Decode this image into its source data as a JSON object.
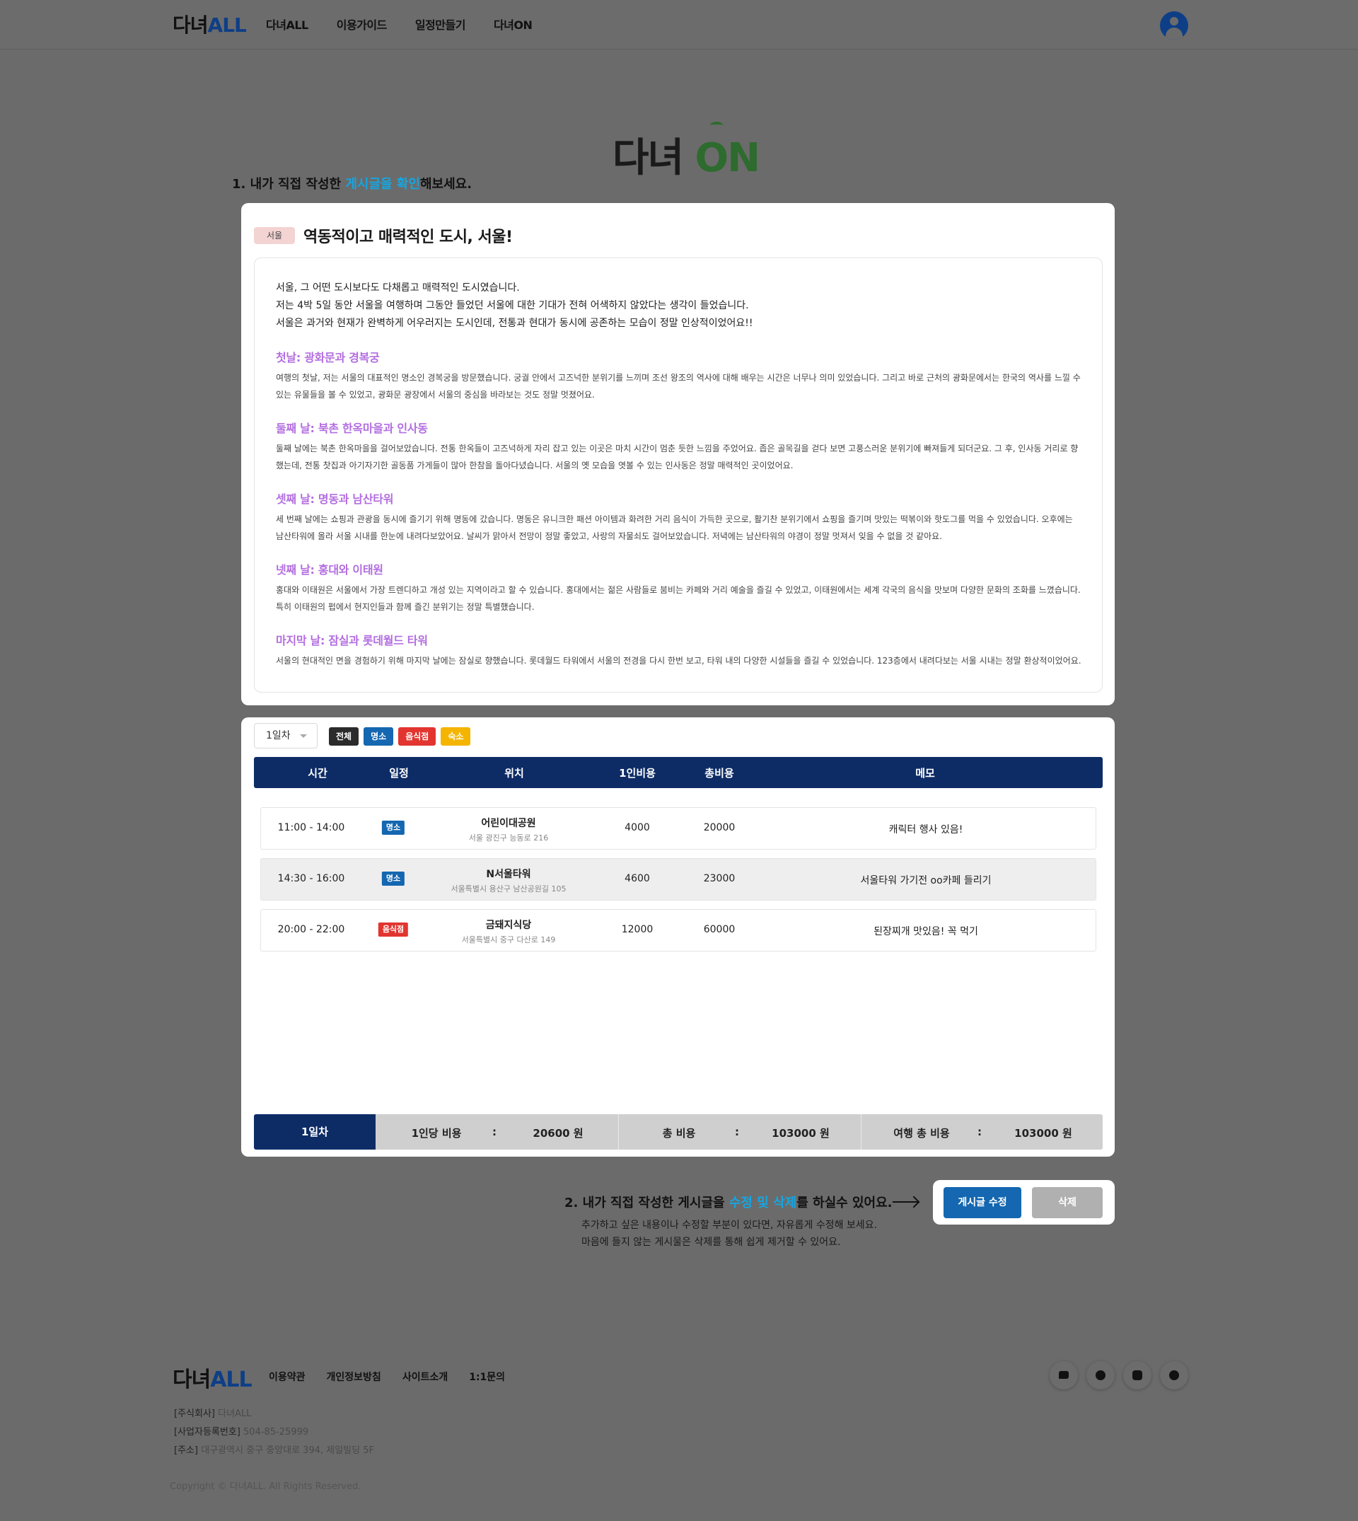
{
  "header": {
    "logo_prefix": "다녀",
    "logo_suffix": "ALL",
    "nav": [
      "다녀ALL",
      "이용가이드",
      "일정만들기",
      "다녀ON"
    ]
  },
  "hero": {
    "logo_prefix": "다녀 ",
    "logo_suffix": "ON"
  },
  "section1": {
    "prefix": "1. 내가 직접 작성한 ",
    "highlight": "게시글을 확인",
    "suffix": "해보세요."
  },
  "post": {
    "region": "서울",
    "title": "역동적이고 매력적인 도시, 서울!",
    "intro": [
      "서울, 그 어떤 도시보다도 다채롭고 매력적인 도시였습니다.",
      "저는 4박 5일 동안 서울을 여행하며 그동안 들었던 서울에 대한 기대가 전혀 어색하지 않았다는 생각이 들었습니다.",
      "서울은 과거와 현재가 완벽하게 어우러지는 도시인데, 전통과 현대가 동시에 공존하는 모습이 정말 인상적이었어요!!"
    ],
    "days": [
      {
        "heading": "첫날: 광화문과 경복궁",
        "text": "여행의 첫날, 저는 서울의 대표적인 명소인 경복궁을 방문했습니다. 궁궐 안에서 고즈넉한 분위기를 느끼며 조선 왕조의 역사에 대해 배우는 시간은 너무나 의미 있었습니다. 그리고 바로 근처의 광화문에서는 한국의 역사를 느낄 수 있는 유물들을 볼 수 있었고, 광화문 광장에서 서울의 중심을 바라보는 것도 정말 멋졌어요."
      },
      {
        "heading": "둘째 날: 북촌 한옥마을과 인사동",
        "text": "둘째 날에는 북촌 한옥마을을 걸어보았습니다. 전통 한옥들이 고즈넉하게 자리 잡고 있는 이곳은 마치 시간이 멈춘 듯한 느낌을 주었어요. 좁은 골목길을 걷다 보면 고풍스러운 분위기에 빠져들게 되더군요. 그 후, 인사동 거리로 향했는데, 전통 찻집과 아기자기한 골동품 가게들이 많아 한참을 돌아다녔습니다. 서울의 옛 모습을 엿볼 수 있는 인사동은 정말 매력적인 곳이었어요."
      },
      {
        "heading": "셋째 날: 명동과 남산타워",
        "text": "세 번째 날에는 쇼핑과 관광을 동시에 즐기기 위해 명동에 갔습니다. 명동은 유니크한 패션 아이템과 화려한 거리 음식이 가득한 곳으로, 활기찬 분위기에서 쇼핑을 즐기며 맛있는 떡볶이와 핫도그를 먹을 수 있었습니다. 오후에는 남산타워에 올라 서울 시내를 한눈에 내려다보았어요. 날씨가 맑아서 전망이 정말 좋았고, 사랑의 자물쇠도 걸어보았습니다. 저녁에는 남산타워의 야경이 정말 멋져서 잊을 수 없을 것 같아요."
      },
      {
        "heading": "넷째 날: 홍대와 이태원",
        "text": "홍대와 이태원은 서울에서 가장 트렌디하고 개성 있는 지역이라고 할 수 있습니다. 홍대에서는 젊은 사람들로 붐비는 카페와 거리 예술을 즐길 수 있었고, 이태원에서는 세계 각국의 음식을 맛보며 다양한 문화의 조화를 느꼈습니다. 특히 이태원의 펍에서 현지인들과 함께 즐긴 분위기는 정말 특별했습니다."
      },
      {
        "heading": "마지막 날: 잠실과 롯데월드 타워",
        "text": "서울의 현대적인 면을 경험하기 위해 마지막 날에는 잠실로 향했습니다. 롯데월드 타워에서 서울의 전경을 다시 한번 보고, 타워 내의 다양한 시설들을 즐길 수 있었습니다. 123층에서 내려다보는 서울 시내는 정말 환상적이었어요."
      }
    ]
  },
  "schedule": {
    "day_select": "1일차",
    "filters": [
      "전체",
      "명소",
      "음식점",
      "숙소"
    ],
    "columns": [
      "시간",
      "일정",
      "위치",
      "1인비용",
      "총비용",
      "메모"
    ],
    "rows": [
      {
        "time": "11:00 - 14:00",
        "type": "명소",
        "place": "어린이대공원",
        "address": "서울 광진구 능동로 216",
        "cost_per_person": "4000",
        "total": "20000",
        "memo": "캐릭터 행사 있음!"
      },
      {
        "time": "14:30 - 16:00",
        "type": "명소",
        "place": "N서울타워",
        "address": "서울특별시 용산구 남산공원길 105",
        "cost_per_person": "4600",
        "total": "23000",
        "memo": "서울타워 가기전 oo카페 들리기"
      },
      {
        "time": "20:00 - 22:00",
        "type": "음식점",
        "place": "금돼지식당",
        "address": "서울특별시 중구 다산로 149",
        "cost_per_person": "12000",
        "total": "60000",
        "memo": "된장찌개 맛있음! 꼭 먹기"
      }
    ],
    "summary": {
      "day": "1일차",
      "per_person_label": "1인당 비용",
      "per_person_value": "20600 원",
      "total_label": "총 비용",
      "total_value": "103000 원",
      "trip_total_label": "여행 총 비용",
      "trip_total_value": "103000 원",
      "colon": ":"
    }
  },
  "section2": {
    "prefix": "2. 내가 직접 작성한 게시글을 ",
    "highlight": "수정 및 삭제",
    "suffix": "를 하실수 있어요.",
    "desc": [
      "추가하고 싶은 내용이나 수정할 부분이 있다면, 자유롭게 수정해 보세요.",
      "마음에 들지 않는 게시물은 삭제를 통해 쉽게 제거할 수 있어요."
    ],
    "edit_button": "게시글 수정",
    "delete_button": "삭제"
  },
  "footer": {
    "logo_prefix": "다녀",
    "logo_suffix": "ALL",
    "links": [
      "이용약관",
      "개인정보방침",
      "사이트소개",
      "1:1문의"
    ],
    "company": [
      {
        "label": "[주식회사]",
        "value": "다녀ALL"
      },
      {
        "label": "[사업자등록번호]",
        "value": "504-85-25999"
      },
      {
        "label": "[주소]",
        "value": "대구광역시 중구 중앙대로 394, 제일빌딩 5F"
      }
    ],
    "copyright": "Copyright © 다녀ALL. All Rights Reserved.",
    "social_icons": [
      "kakao-talk-icon",
      "facebook-icon",
      "instagram-icon",
      "youtube-icon"
    ]
  },
  "colors": {
    "navy": "#0d2c66",
    "blue": "#1467b0",
    "highlight": "#15a6e0",
    "purple_heading": "#b36ee0",
    "red": "#e2352f",
    "yellow": "#f4b400"
  }
}
